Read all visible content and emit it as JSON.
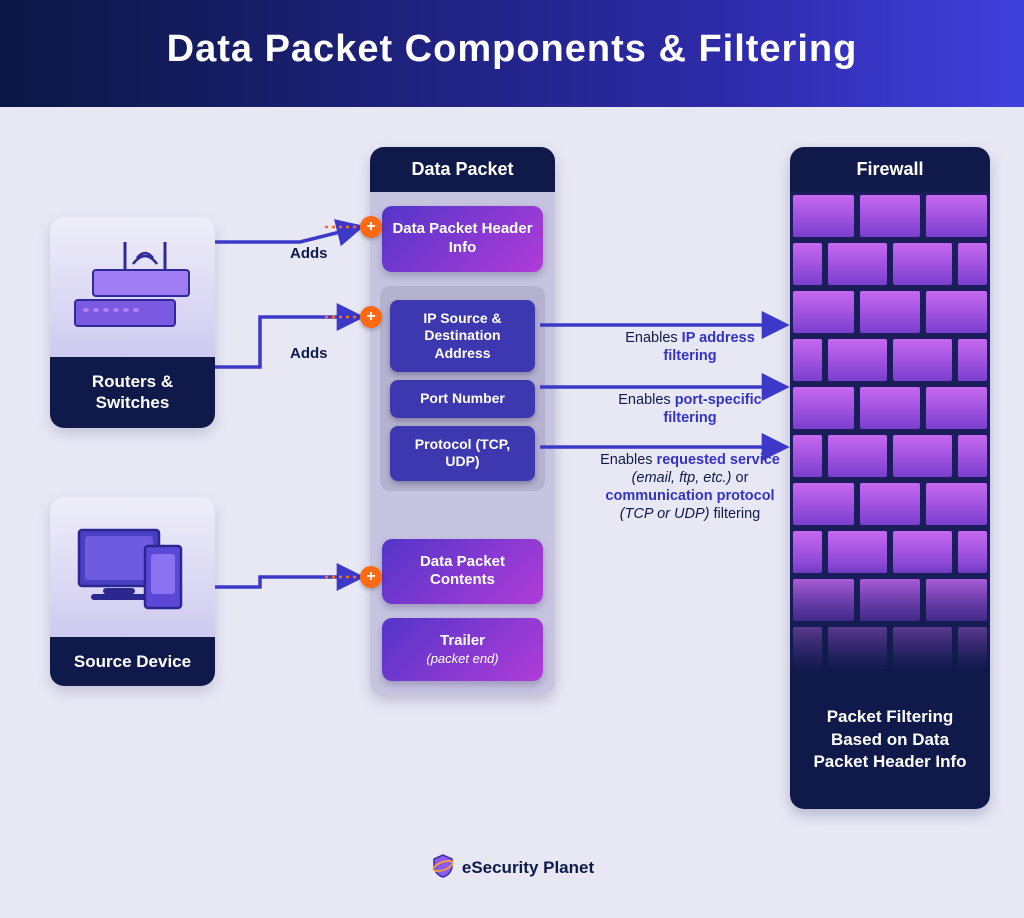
{
  "title": "Data Packet Components & Filtering",
  "left": {
    "routers": "Routers & Switches",
    "source": "Source Device"
  },
  "adds": {
    "top": "Adds",
    "mid": "Adds"
  },
  "packet": {
    "col_title": "Data Packet",
    "header_info": "Data Packet Header Info",
    "ip": "IP Source & Destination Address",
    "port": "Port Number",
    "protocol": "Protocol (TCP, UDP)",
    "contents": "Data Packet Contents",
    "trailer": "Trailer",
    "trailer_sub": "(packet end)"
  },
  "firewall": {
    "col_title": "Firewall",
    "bottom": "Packet Filtering Based on Data Packet Header Info"
  },
  "enables": {
    "ip_pre": "Enables ",
    "ip_b": "IP address filtering",
    "port_pre": "Enables ",
    "port_b": "port-specific filtering",
    "proto_pre": "Enables ",
    "proto_b1": "requested service",
    "proto_i1": " (email, ftp, etc.)",
    "proto_mid": " or ",
    "proto_b2": "communication protocol",
    "proto_i2": " (TCP or UDP)",
    "proto_post": " filtering"
  },
  "footer": "eSecurity Planet"
}
